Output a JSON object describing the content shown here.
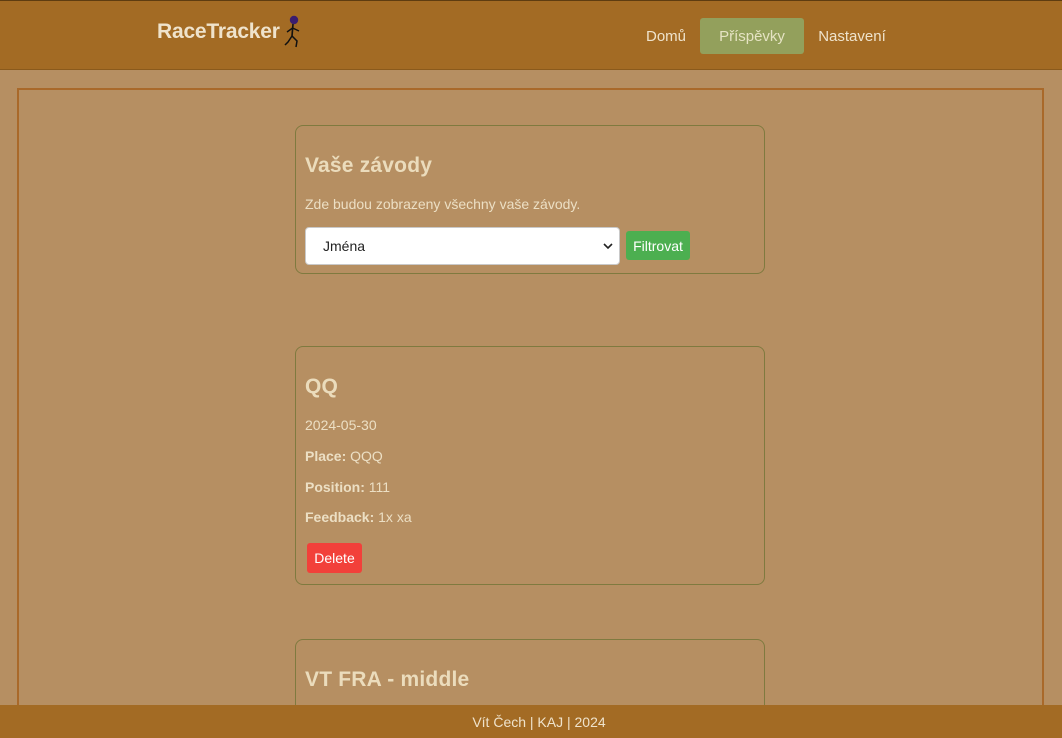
{
  "header": {
    "brand": "RaceTracker",
    "logo_icon": "runner-icon",
    "nav": {
      "home": "Domů",
      "posts": "Příspěvky",
      "settings": "Nastavení"
    }
  },
  "filter": {
    "title": "Vaše závody",
    "description": "Zde budou zobrazeny všechny vaše závody.",
    "select_value": "Jména",
    "button_label": "Filtrovat"
  },
  "races": [
    {
      "name": "QQ",
      "date": "2024-05-30",
      "place_label": "Place:",
      "place": "QQQ",
      "position_label": "Position:",
      "position": "111",
      "feedback_label": "Feedback:",
      "feedback": "1x xa",
      "delete_label": "Delete"
    },
    {
      "name": "VT FRA - middle"
    }
  ],
  "footer": {
    "text": "Vít Čech | KAJ | 2024"
  },
  "colors": {
    "header": "#a36b24",
    "background": "#b68f62",
    "active_nav": "#93a05c",
    "filter_button": "#4caf50",
    "delete_button": "#f2403a"
  }
}
